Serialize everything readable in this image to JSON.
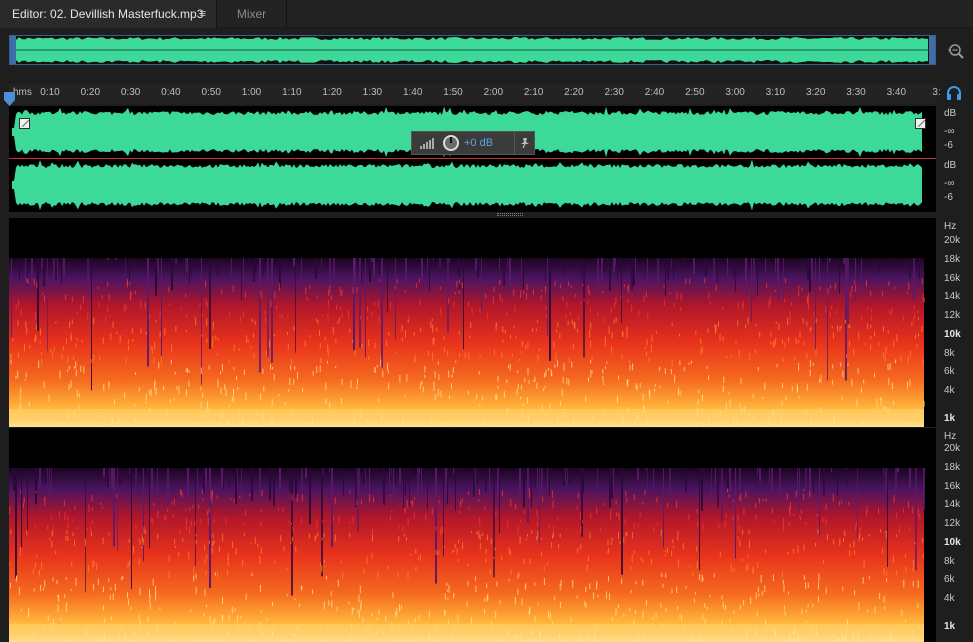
{
  "tabs": {
    "editor_label": "Editor: 02. Devillish Masterfuck.mp3",
    "editor_menu_icon": "≡",
    "mixer_label": "Mixer"
  },
  "ruler": {
    "unit": "hms",
    "labels": [
      "0:10",
      "0:20",
      "0:30",
      "0:40",
      "0:50",
      "1:00",
      "1:10",
      "1:20",
      "1:30",
      "1:40",
      "1:50",
      "2:00",
      "2:10",
      "2:20",
      "2:30",
      "2:40",
      "2:50",
      "3:00",
      "3:10",
      "3:20",
      "3:30",
      "3:40",
      "3:"
    ]
  },
  "hud": {
    "gain_text": "+0 dB"
  },
  "amplitude_scale": {
    "channel1": [
      "dB",
      "-∞",
      "-6"
    ],
    "channel2": [
      "dB",
      "-∞",
      "-6"
    ]
  },
  "frequency_scale": {
    "channel1": [
      "Hz",
      "20k",
      "18k",
      "16k",
      "14k",
      "12k",
      "10k",
      "8k",
      "6k",
      "4k",
      "1k"
    ],
    "channel2": [
      "Hz",
      "20k",
      "18k",
      "16k",
      "14k",
      "12k",
      "10k",
      "8k",
      "6k",
      "4k",
      "1k"
    ]
  },
  "colors": {
    "waveform": "#3dd999",
    "selection_border": "#3a5f8a",
    "accent": "#57a6e0",
    "spectrum_low": "#ffd36a",
    "spectrum_mid": "#e8321c",
    "spectrum_high": "#4a1460"
  },
  "icons": {
    "zoom": "zoom-magnifier-icon",
    "loop": "headphones-icon",
    "playhead": "playhead-marker-icon",
    "hud_pin": "pin-icon",
    "hud_knob": "volume-knob-icon",
    "hud_meter": "level-meter-icon"
  }
}
